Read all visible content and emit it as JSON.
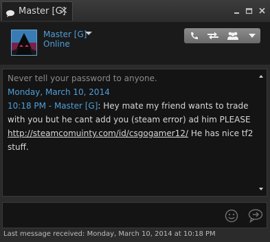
{
  "tab": {
    "title": "Master [G]"
  },
  "friend": {
    "name": "Master [G]",
    "status": "Online"
  },
  "chat": {
    "warning": "Never tell your password to anyone.",
    "date": "Monday, March 10, 2014",
    "messages": [
      {
        "meta": "10:18 PM - Master [G]",
        "text_before": ": Hey mate my friend wants to trade with you but he cant add you (steam error) ad him PLEASE",
        "link": "http://steamcomuinty.com/id/csgogamer12/",
        "text_after": " He has nice tf2 stuff."
      }
    ]
  },
  "footer": {
    "status": "Last message received: Monday, March 10, 2014 at 10:18 PM"
  },
  "icons": {
    "tab": "chat-bubble-icon",
    "call": "phone-icon",
    "trade": "trade-arrows-icon",
    "group": "group-icon",
    "more": "chevron-down-icon",
    "emoticon": "smiley-icon",
    "send": "send-bubble-icon"
  },
  "colors": {
    "accent": "#4f9fda",
    "background": "#2b2b2b",
    "chat_bg": "#141414"
  }
}
